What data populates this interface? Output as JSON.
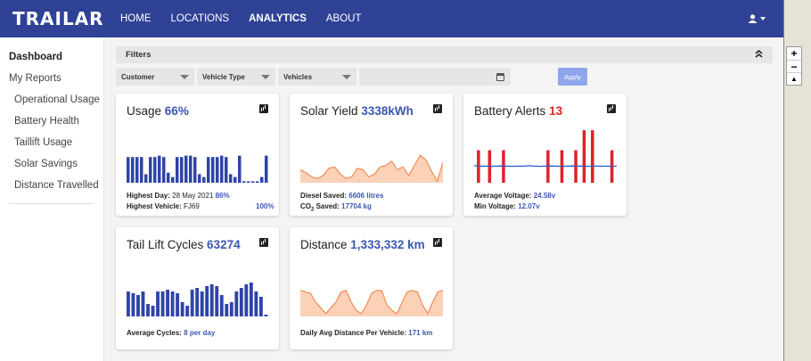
{
  "app": {
    "logo": "TRAILAR"
  },
  "nav": [
    {
      "label": "HOME",
      "active": false
    },
    {
      "label": "LOCATIONS",
      "active": false
    },
    {
      "label": "ANALYTICS",
      "active": true
    },
    {
      "label": "ABOUT",
      "active": false
    }
  ],
  "sidebar": {
    "items": [
      {
        "label": "Dashboard",
        "style": "bold"
      },
      {
        "label": "My Reports",
        "style": "normal"
      },
      {
        "label": "Operational Usage",
        "style": "sub"
      },
      {
        "label": "Battery Health",
        "style": "sub"
      },
      {
        "label": "Taillift Usage",
        "style": "sub"
      },
      {
        "label": "Solar Savings",
        "style": "sub"
      },
      {
        "label": "Distance Travelled",
        "style": "sub"
      }
    ]
  },
  "filters": {
    "title": "Filters",
    "customer": "Customer",
    "vehicle_type": "Vehicle Type",
    "vehicles": "Vehicles",
    "date_value": "",
    "apply": "Apply"
  },
  "cards": {
    "usage": {
      "title": "Usage",
      "value": "66%",
      "highest_day_label": "Highest Day:",
      "highest_day": "28 May 2021",
      "highest_day_pct": "86%",
      "highest_vehicle_label": "Highest Vehicle:",
      "highest_vehicle": "FJ69",
      "highest_vehicle_pct": "100%"
    },
    "solar": {
      "title": "Solar Yield",
      "value": "3338kWh",
      "diesel_label": "Diesel Saved:",
      "diesel_value": "6606 litres",
      "co2_label": "CO",
      "co2_sub": "2",
      "co2_suffix": " Saved:",
      "co2_value": "17704 kg"
    },
    "battery": {
      "title": "Battery Alerts",
      "value": "13",
      "avg_label": "Average Voltage:",
      "avg_value": "24.58v",
      "min_label": "Min Voltage:",
      "min_value": "12.07v"
    },
    "taillift": {
      "title": "Tail Lift Cycles",
      "value": "63274",
      "avg_label": "Average Cycles:",
      "avg_value": "8 per day"
    },
    "distance": {
      "title": "Distance",
      "value": "1,333,332 km",
      "avg_label": "Daily Avg Distance Per Vehicle:",
      "avg_value": "171 km"
    }
  },
  "chart_data": [
    {
      "type": "bar",
      "id": "usage",
      "color": "#2f44a8",
      "values": [
        0.9,
        0.9,
        0.9,
        0.9,
        0.3,
        0.9,
        0.9,
        0.95,
        0.9,
        0.35,
        0.2,
        0.9,
        0.9,
        0.95,
        0.95,
        0.9,
        0.3,
        0.2,
        0.9,
        0.9,
        0.9,
        0.95,
        0.9,
        0.3,
        0.2,
        0.95,
        0.05,
        0.05,
        0.05,
        0.05,
        0.2,
        0.95
      ]
    },
    {
      "type": "area",
      "id": "solar",
      "color": "#f28c54",
      "fill": "#fbd1b8",
      "values": [
        0.45,
        0.35,
        0.2,
        0.15,
        0.25,
        0.5,
        0.55,
        0.3,
        0.15,
        0.2,
        0.5,
        0.45,
        0.2,
        0.3,
        0.55,
        0.6,
        0.75,
        0.45,
        0.55,
        0.25,
        0.6,
        0.95,
        0.8,
        0.4,
        0.05,
        0.7
      ]
    },
    {
      "type": "line",
      "id": "battery",
      "color": "#2f58c0",
      "bar_color": "#e0202b",
      "values": [
        0.55,
        0.5,
        0.5,
        0.48,
        0.5,
        0.52,
        0.5,
        0.48,
        0.5,
        0.5,
        0.55,
        0.5,
        0.48,
        0.5,
        0.52,
        0.5,
        0.48,
        0.5,
        0.52,
        0.5,
        0.5,
        0.48,
        0.5,
        0.5,
        0.5,
        0.48,
        0.5
      ],
      "alert_bars": [
        {
          "x": 0.02,
          "h": 0.62
        },
        {
          "x": 0.1,
          "h": 0.62
        },
        {
          "x": 0.2,
          "h": 0.62
        },
        {
          "x": 0.52,
          "h": 0.62
        },
        {
          "x": 0.62,
          "h": 0.62
        },
        {
          "x": 0.72,
          "h": 0.62
        },
        {
          "x": 0.78,
          "h": 1.0
        },
        {
          "x": 0.84,
          "h": 1.0
        },
        {
          "x": 0.98,
          "h": 0.62
        }
      ]
    },
    {
      "type": "bar",
      "id": "taillift",
      "color": "#2f44a8",
      "values": [
        0.7,
        0.65,
        0.6,
        0.7,
        0.35,
        0.3,
        0.7,
        0.7,
        0.75,
        0.7,
        0.65,
        0.4,
        0.3,
        0.75,
        0.8,
        0.7,
        0.85,
        0.9,
        0.85,
        0.6,
        0.35,
        0.4,
        0.7,
        0.8,
        0.9,
        0.95,
        0.7,
        0.55,
        0.05
      ]
    },
    {
      "type": "area",
      "id": "distance",
      "color": "#f28c54",
      "fill": "#fbd1b8",
      "values": [
        0.9,
        0.85,
        0.8,
        0.5,
        0.3,
        0.1,
        0.3,
        0.5,
        0.85,
        0.9,
        0.5,
        0.2,
        0.1,
        0.4,
        0.8,
        0.9,
        0.9,
        0.4,
        0.2,
        0.1,
        0.5,
        0.85,
        0.9,
        0.85,
        0.4,
        0.1,
        0.5,
        0.85,
        0.9
      ]
    }
  ]
}
